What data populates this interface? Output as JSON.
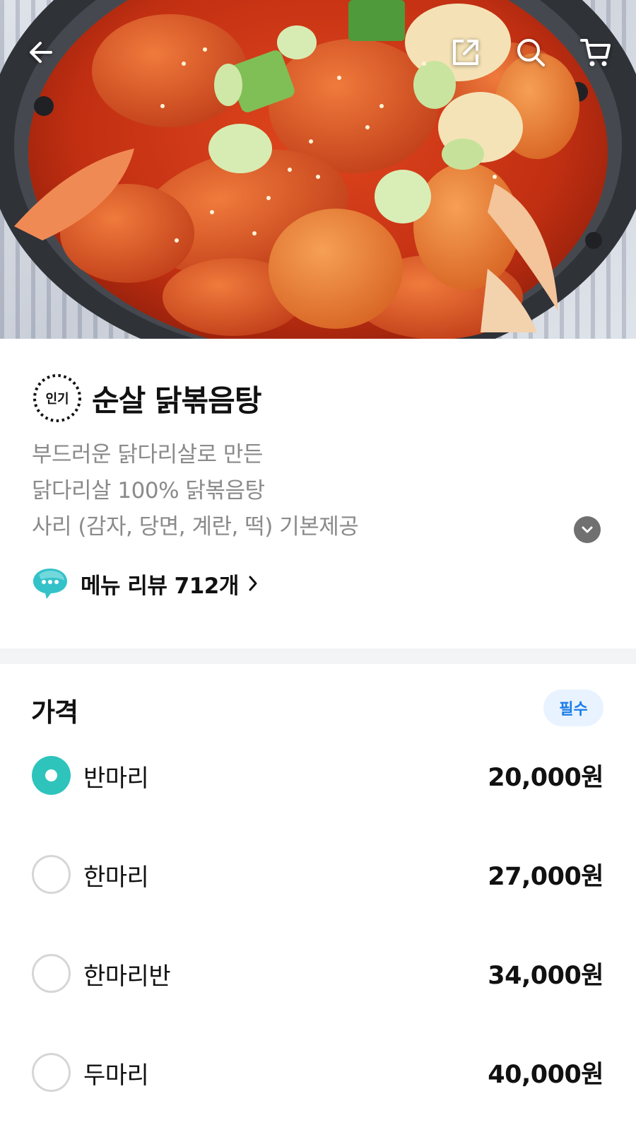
{
  "hero": {
    "image": "spicy-braised-chicken-stew-photo"
  },
  "nav": {
    "back_icon": "arrow-left-icon",
    "share_icon": "share-icon",
    "search_icon": "search-icon",
    "cart_icon": "cart-icon"
  },
  "menu": {
    "badge": "인기",
    "title": "순살 닭볶음탕",
    "description": [
      "부드러운 닭다리살로 만든",
      "닭다리살 100% 닭볶음탕",
      "사리 (감자, 당면, 계란, 떡) 기본제공"
    ],
    "review_text": "메뉴 리뷰 712개"
  },
  "price_section": {
    "title": "가격",
    "required_label": "필수",
    "options": [
      {
        "label": "반마리",
        "price": "20,000원",
        "selected": true
      },
      {
        "label": "한마리",
        "price": "27,000원",
        "selected": false
      },
      {
        "label": "한마리반",
        "price": "34,000원",
        "selected": false
      },
      {
        "label": "두마리",
        "price": "40,000원",
        "selected": false
      }
    ]
  },
  "colors": {
    "accent": "#2ec4bc",
    "required_bg": "#e8f3ff",
    "required_text": "#1b7ce8",
    "review_icon": "#34c2c9"
  }
}
